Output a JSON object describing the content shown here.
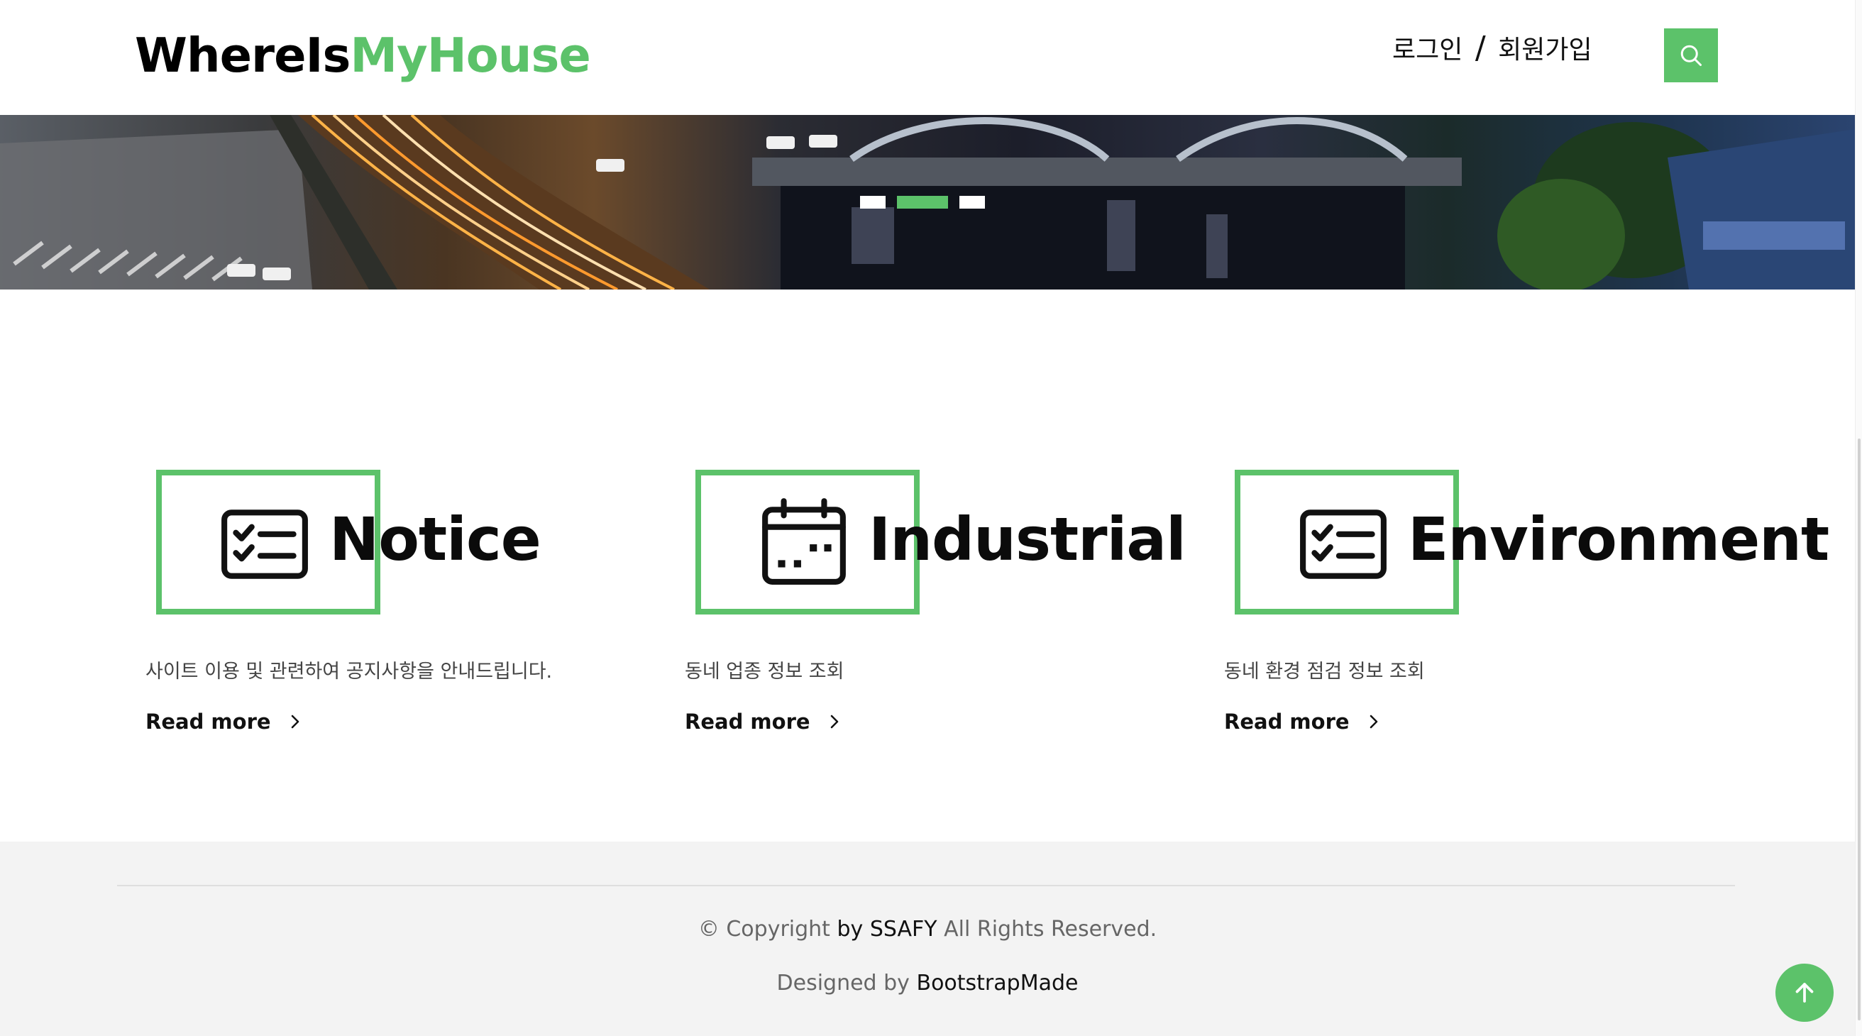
{
  "header": {
    "logo_part1": "WhereIs",
    "logo_part2": "MyHouse",
    "login": "로그인",
    "separator": "/",
    "signup": "회원가입",
    "search_icon": "search-icon"
  },
  "hero": {
    "slides": 3,
    "active_slide": 2
  },
  "services": [
    {
      "icon": "checklist-icon",
      "title": "Notice",
      "desc": "사이트 이용 및 관련하여 공지사항을 안내드립니다.",
      "more": "Read more"
    },
    {
      "icon": "calendar-icon",
      "title": "Industrial",
      "desc": "동네 업종 정보 조회",
      "more": "Read more"
    },
    {
      "icon": "checklist-icon",
      "title": "Environment",
      "desc": "동네 환경 점검 정보 조회",
      "more": "Read more"
    }
  ],
  "footer": {
    "copyright_prefix": "© Copyright",
    "copyright_owner": "by SSAFY",
    "copyright_suffix": "All Rights Reserved.",
    "designed_prefix": "Designed by",
    "designed_by": "BootstrapMade"
  },
  "colors": {
    "accent": "#5cc26a"
  }
}
